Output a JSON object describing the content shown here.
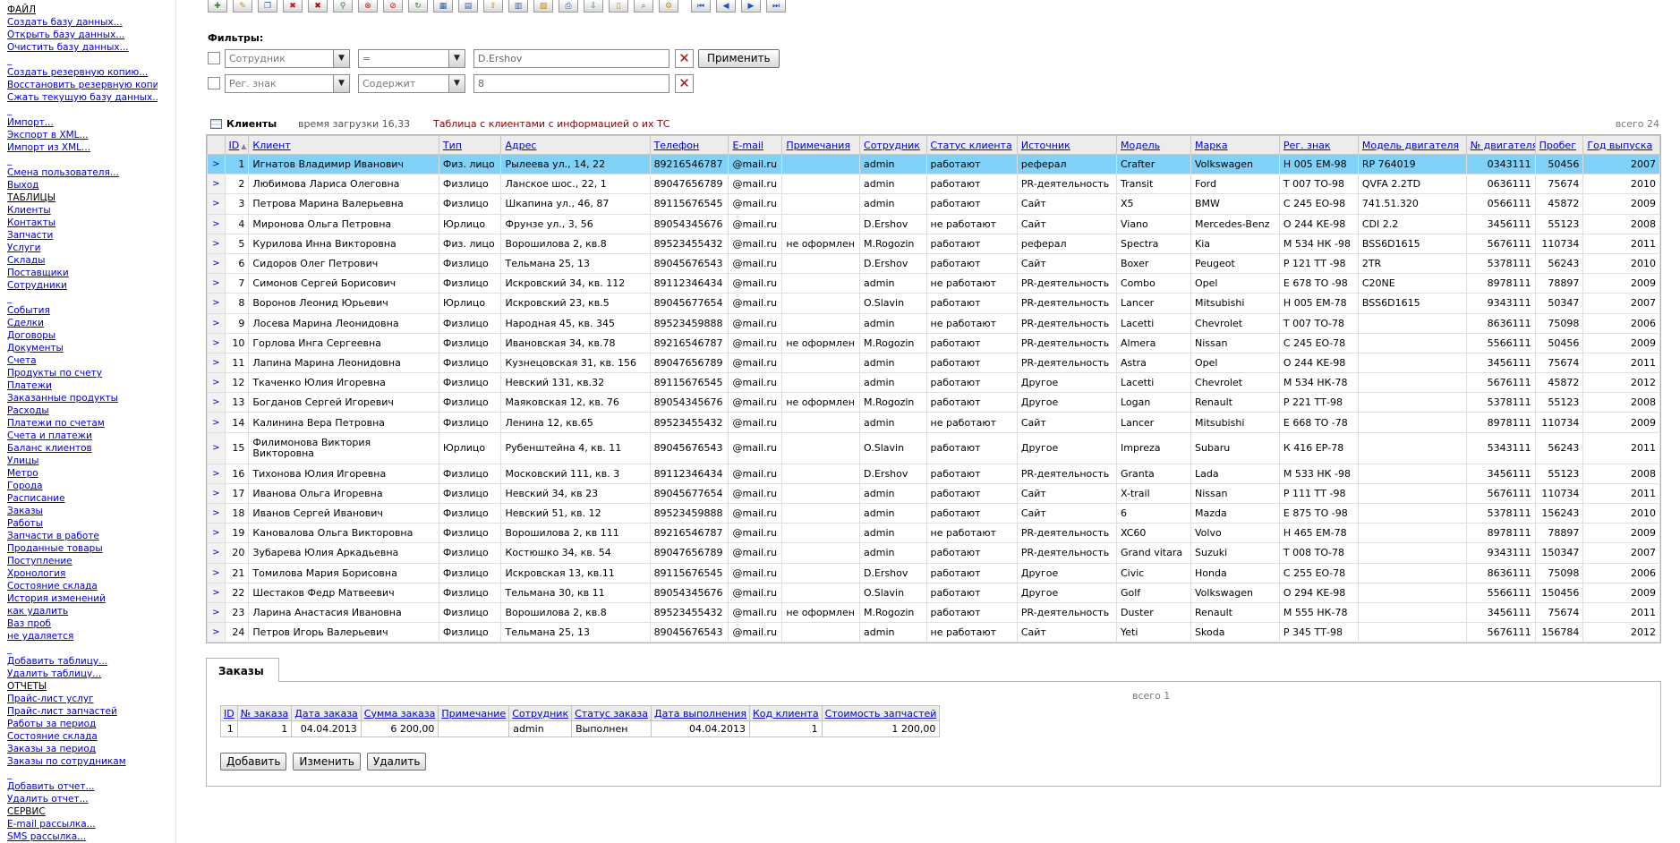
{
  "sidebar": {
    "items": [
      {
        "t": "ФАЙЛ",
        "k": "hdr"
      },
      {
        "t": "Создать базу данных...",
        "k": "lnk"
      },
      {
        "t": "Открыть базу данных...",
        "k": "lnk"
      },
      {
        "t": "Очистить базу данных...",
        "k": "lnk"
      },
      {
        "t": "_",
        "k": "sep"
      },
      {
        "t": "Создать резервную копию...",
        "k": "lnk"
      },
      {
        "t": "Восстановить резервную копию...",
        "k": "lnk"
      },
      {
        "t": "Сжать текущую базу данных...",
        "k": "lnk"
      },
      {
        "t": "_",
        "k": "sep"
      },
      {
        "t": "Импорт...",
        "k": "lnk"
      },
      {
        "t": "Экспорт в XML...",
        "k": "lnk"
      },
      {
        "t": "Импорт из XML...",
        "k": "lnk"
      },
      {
        "t": "_",
        "k": "sep"
      },
      {
        "t": "Смена пользователя...",
        "k": "lnk"
      },
      {
        "t": "Выход",
        "k": "lnk"
      },
      {
        "t": "ТАБЛИЦЫ",
        "k": "hdr"
      },
      {
        "t": "Клиенты",
        "k": "lnk"
      },
      {
        "t": "Контакты",
        "k": "lnk"
      },
      {
        "t": "Запчасти",
        "k": "lnk"
      },
      {
        "t": "Услуги",
        "k": "lnk"
      },
      {
        "t": "Склады",
        "k": "lnk"
      },
      {
        "t": "Поставщики",
        "k": "lnk"
      },
      {
        "t": "Сотрудники",
        "k": "lnk"
      },
      {
        "t": "_",
        "k": "sep"
      },
      {
        "t": "События",
        "k": "lnk"
      },
      {
        "t": "Сделки",
        "k": "lnk"
      },
      {
        "t": "Договоры",
        "k": "lnk"
      },
      {
        "t": "Документы",
        "k": "lnk"
      },
      {
        "t": "Счета",
        "k": "lnk"
      },
      {
        "t": "Продукты по счету",
        "k": "lnk"
      },
      {
        "t": "Платежи",
        "k": "lnk"
      },
      {
        "t": "Заказанные продукты",
        "k": "lnk"
      },
      {
        "t": "Расходы",
        "k": "lnk"
      },
      {
        "t": "Платежи по счетам",
        "k": "lnk"
      },
      {
        "t": "Счета и платежи",
        "k": "lnk"
      },
      {
        "t": "Баланс клиентов",
        "k": "lnk"
      },
      {
        "t": "Улицы",
        "k": "lnk"
      },
      {
        "t": "Метро",
        "k": "lnk"
      },
      {
        "t": "Города",
        "k": "lnk"
      },
      {
        "t": "Расписание",
        "k": "lnk"
      },
      {
        "t": "Заказы",
        "k": "lnk"
      },
      {
        "t": "Работы",
        "k": "lnk"
      },
      {
        "t": "Запчасти в работе",
        "k": "lnk"
      },
      {
        "t": "Проданные товары",
        "k": "lnk"
      },
      {
        "t": "Поступление",
        "k": "lnk"
      },
      {
        "t": "Хронология",
        "k": "lnk"
      },
      {
        "t": "Состояние склада",
        "k": "lnk"
      },
      {
        "t": "История изменений",
        "k": "lnk"
      },
      {
        "t": "как удалить",
        "k": "lnk"
      },
      {
        "t": "Ваз проб",
        "k": "lnk"
      },
      {
        "t": "не удаляется",
        "k": "lnk"
      },
      {
        "t": "_",
        "k": "sep"
      },
      {
        "t": "Добавить таблицу...",
        "k": "lnk"
      },
      {
        "t": "Удалить таблицу...",
        "k": "lnk"
      },
      {
        "t": "ОТЧЕТЫ",
        "k": "hdr"
      },
      {
        "t": "Прайс-лист услуг",
        "k": "lnk"
      },
      {
        "t": "Прайс-лист запчастей",
        "k": "lnk"
      },
      {
        "t": "Работы за период",
        "k": "lnk"
      },
      {
        "t": "Состояние склада",
        "k": "lnk"
      },
      {
        "t": "Заказы за период",
        "k": "lnk"
      },
      {
        "t": "Заказы по сотрудникам",
        "k": "lnk"
      },
      {
        "t": "_",
        "k": "sep"
      },
      {
        "t": "Добавить отчет...",
        "k": "lnk"
      },
      {
        "t": "Удалить отчет...",
        "k": "lnk"
      },
      {
        "t": "СЕРВИС",
        "k": "hdr"
      },
      {
        "t": "E-mail рассылка...",
        "k": "lnk"
      },
      {
        "t": "SMS рассылка...",
        "k": "lnk"
      }
    ]
  },
  "toolbar": {
    "buttons": [
      {
        "name": "add-record-icon",
        "glyph": "✚",
        "color": "#2f8a2f"
      },
      {
        "name": "edit-record-icon",
        "glyph": "✎",
        "color": "#c78a00"
      },
      {
        "name": "copy-record-icon",
        "glyph": "❐",
        "color": "#2f5fb0"
      },
      {
        "name": "delete-record-icon",
        "glyph": "✖",
        "color": "#d01010"
      },
      {
        "name": "delete-all-icon",
        "glyph": "✖",
        "color": "#b00000"
      },
      {
        "name": "filter-icon",
        "glyph": "⚲",
        "color": "#2f8a2f"
      },
      {
        "name": "clear-filter-icon",
        "glyph": "⊗",
        "color": "#d01010"
      },
      {
        "name": "remove-filter-icon",
        "glyph": "⊘",
        "color": "#d01010"
      },
      {
        "name": "refresh-icon",
        "glyph": "↻",
        "color": "#2f8a2f"
      },
      {
        "name": "columns-icon",
        "glyph": "▦",
        "color": "#2f5fb0"
      },
      {
        "name": "table-settings-icon",
        "glyph": "▤",
        "color": "#2f5fb0"
      },
      {
        "name": "export-icon",
        "glyph": "⇪",
        "color": "#c78a00"
      },
      {
        "name": "report-icon",
        "glyph": "▥",
        "color": "#2f5fb0"
      },
      {
        "name": "chart-icon",
        "glyph": "▧",
        "color": "#c78a00"
      },
      {
        "name": "print-icon",
        "glyph": "⎙",
        "color": "#2f5fb0"
      },
      {
        "name": "import-icon",
        "glyph": "⇩",
        "color": "#2f8a2f"
      },
      {
        "name": "document-icon",
        "glyph": "▯",
        "color": "#c78a00"
      },
      {
        "name": "search-icon",
        "glyph": "⌕",
        "color": "#2f5fb0"
      },
      {
        "name": "settings-icon",
        "glyph": "⚙",
        "color": "#c78a00"
      },
      {
        "name": "first-page-icon",
        "glyph": "⏮",
        "color": "#1a4fd0",
        "gap": true
      },
      {
        "name": "prev-page-icon",
        "glyph": "◀",
        "color": "#1a4fd0"
      },
      {
        "name": "next-page-icon",
        "glyph": "▶",
        "color": "#1a4fd0"
      },
      {
        "name": "last-page-icon",
        "glyph": "⏭",
        "color": "#1a4fd0"
      }
    ]
  },
  "filters": {
    "title": "Фильтры:",
    "apply_label": "Применить",
    "rows": [
      {
        "field": "Сотрудник",
        "op": "=",
        "value": "D.Ershov"
      },
      {
        "field": "Рег. знак",
        "op": "Содержит",
        "value": "8"
      }
    ]
  },
  "clients": {
    "title": "Клиенты",
    "load_time": "время загрузки 16,33",
    "description": "Таблица с клиентами с информацией о их ТС",
    "total": "всего 24",
    "columns": [
      "ID",
      "Клиент",
      "Тип",
      "Адрес",
      "Телефон",
      "E-mail",
      "Примечания",
      "Сотрудник",
      "Статус клиента",
      "Источник",
      "Модель",
      "Марка",
      "Рег. знак",
      "Модель двигателя",
      "№ двигателя",
      "Пробег",
      "Год выпуска"
    ],
    "id_sort_mark": "▲",
    "rows": [
      [
        "1",
        "Игнатов Владимир Иванович",
        "Физ. лицо",
        "Рылеева ул., 14, 22",
        "89216546787",
        "@mail.ru",
        "",
        "admin",
        "работают",
        "реферал",
        "Crafter",
        "Volkswagen",
        "Н 005 ЕМ-98",
        "RP 764019",
        "0343111",
        "50456",
        "2007"
      ],
      [
        "2",
        "Любимова Лариса Олеговна",
        "Физлицо",
        "Ланское шос., 22, 1",
        "89047656789",
        "@mail.ru",
        "",
        "admin",
        "работают",
        "PR-деятельность",
        "Transit",
        "Ford",
        "Т 007 ТО-98",
        "QVFA 2.2TD",
        "0636111",
        "75674",
        "2010"
      ],
      [
        "3",
        "Петрова Марина Валерьевна",
        "Физлицо",
        "Шкапина ул., 46, 87",
        "89115676545",
        "@mail.ru",
        "",
        "admin",
        "работают",
        "Сайт",
        "X5",
        "BMW",
        "С 245 ЕО-98",
        "741.51.320",
        "0566111",
        "45872",
        "2009"
      ],
      [
        "4",
        "Миронова Ольга Петровна",
        "Юрлицо",
        "Фрунзе ул., 3, 56",
        "89054345676",
        "@mail.ru",
        "",
        "D.Ershov",
        "не работают",
        "Сайт",
        "Viano",
        "Mercedes-Benz",
        "О 244 КЕ-98",
        "CDI 2.2",
        "3456111",
        "55123",
        "2008"
      ],
      [
        "5",
        "Курилова Инна Викторовна",
        "Физ. лицо",
        "Ворошилова 2, кв.8",
        "89523455432",
        "@mail.ru",
        "не оформлен",
        "M.Rogozin",
        "работают",
        "реферал",
        "Spectra",
        "Kia",
        "М 534 НК -98",
        "BSS6D1615",
        "5676111",
        "110734",
        "2011"
      ],
      [
        "6",
        "Сидоров Олег Петрович",
        "Физлицо",
        "Тельмана 25, 13",
        "89045676543",
        "@mail.ru",
        "",
        "D.Ershov",
        "работают",
        "Сайт",
        "Boxer",
        "Peugeot",
        "Р 121 ТТ -98",
        "2TR",
        "5378111",
        "56243",
        "2010"
      ],
      [
        "7",
        "Симонов Сергей Борисович",
        "Физлицо",
        "Искровский 34, кв. 112",
        "89112346434",
        "@mail.ru",
        "",
        "admin",
        "не работают",
        "PR-деятельность",
        "Combo",
        "Opel",
        "Е 678 ТО -98",
        "C20NE",
        "8978111",
        "78897",
        "2009"
      ],
      [
        "8",
        "Воронов Леонид Юрьевич",
        "Юрлицо",
        "Искровский 23, кв.5",
        "89045677654",
        "@mail.ru",
        "",
        "O.Slavin",
        "работают",
        "PR-деятельность",
        "Lancer",
        "Mitsubishi",
        "Н 005 ЕМ-78",
        "BSS6D1615",
        "9343111",
        "50347",
        "2007"
      ],
      [
        "9",
        "Лосева Марина Леонидовна",
        "Физлицо",
        "Народная 45, кв. 345",
        "89523459888",
        "@mail.ru",
        "",
        "admin",
        "не работают",
        "PR-деятельность",
        "Lacetti",
        "Chevrolet",
        "Т 007 ТО-78",
        "",
        "8636111",
        "75098",
        "2006"
      ],
      [
        "10",
        "Горлова Инга Сергеевна",
        "Физлицо",
        "Ивановская 34, кв.78",
        "89216546787",
        "@mail.ru",
        "не оформлен",
        "M.Rogozin",
        "работают",
        "PR-деятельность",
        "Almera",
        "Nissan",
        "С 245 ЕО-78",
        "",
        "5566111",
        "50456",
        "2009"
      ],
      [
        "11",
        "Лапина Марина Леонидовна",
        "Физлицо",
        "Кузнецовская 31, кв. 156",
        "89047656789",
        "@mail.ru",
        "",
        "admin",
        "работают",
        "PR-деятельность",
        "Astra",
        "Opel",
        "О 244 КЕ-98",
        "",
        "3456111",
        "75674",
        "2011"
      ],
      [
        "12",
        "Ткаченко Юлия Игоревна",
        "Физлицо",
        "Невский 131, кв.32",
        "89115676545",
        "@mail.ru",
        "",
        "admin",
        "работают",
        "Другое",
        "Lacetti",
        "Chevrolet",
        "М 534 НК-78",
        "",
        "5676111",
        "45872",
        "2012"
      ],
      [
        "13",
        "Богданов Сергей Игоревич",
        "Физлицо",
        "Маяковская 12, кв. 76",
        "89054345676",
        "@mail.ru",
        "не оформлен",
        "M.Rogozin",
        "работают",
        "Другое",
        "Logan",
        "Renault",
        "Р 221 ТТ-98",
        "",
        "5378111",
        "55123",
        "2008"
      ],
      [
        "14",
        "Калинина Вера Петровна",
        "Физлицо",
        "Ленина 12, кв.65",
        "89523455432",
        "@mail.ru",
        "",
        "admin",
        "не работают",
        "Сайт",
        "Lancer",
        "Mitsubishi",
        "Е 668 ТО -78",
        "",
        "8978111",
        "110734",
        "2009"
      ],
      [
        "15",
        "Филимонова Виктория Викторовна",
        "Юрлицо",
        "Рубенштейна 4, кв. 11",
        "89045676543",
        "@mail.ru",
        "",
        "O.Slavin",
        "работают",
        "Другое",
        "Impreza",
        "Subaru",
        "К 416 ЕР-78",
        "",
        "5343111",
        "56243",
        "2011"
      ],
      [
        "16",
        "Тихонова Юлия Игоревна",
        "Физлицо",
        "Московский 111, кв. 3",
        "89112346434",
        "@mail.ru",
        "",
        "D.Ershov",
        "работают",
        "PR-деятельность",
        "Granta",
        "Lada",
        "М 533 НК -98",
        "",
        "3456111",
        "55123",
        "2008"
      ],
      [
        "17",
        "Иванова Ольга Игоревна",
        "Физлицо",
        "Невский 34, кв 23",
        "89045677654",
        "@mail.ru",
        "",
        "admin",
        "работают",
        "Сайт",
        "X-trail",
        "Nissan",
        "Р 111 ТТ -98",
        "",
        "5676111",
        "110734",
        "2011"
      ],
      [
        "18",
        "Иванов Сергей Иванович",
        "Физлицо",
        "Невский 51, кв. 12",
        "89523459888",
        "@mail.ru",
        "",
        "admin",
        "работают",
        "Сайт",
        "6",
        "Mazda",
        "Е 875 ТО -98",
        "",
        "5378111",
        "156243",
        "2010"
      ],
      [
        "19",
        "Кановалова Ольга Викторовна",
        "Физлицо",
        "Ворошилова 2, кв 111",
        "89216546787",
        "@mail.ru",
        "",
        "admin",
        "не работают",
        "PR-деятельность",
        "XC60",
        "Volvo",
        "Н 465 ЕМ-78",
        "",
        "8978111",
        "78897",
        "2009"
      ],
      [
        "20",
        "Зубарева Юлия Аркадьевна",
        "Физлицо",
        "Костюшко 34, кв. 54",
        "89047656789",
        "@mail.ru",
        "",
        "admin",
        "работают",
        "PR-деятельность",
        "Grand vitara",
        "Suzuki",
        "Т 008 ТО-78",
        "",
        "9343111",
        "150347",
        "2007"
      ],
      [
        "21",
        "Томилова Мария Борисовна",
        "Физлицо",
        "Искровская 13, кв.11",
        "89115676545",
        "@mail.ru",
        "",
        "D.Ershov",
        "работают",
        "Другое",
        "Civic",
        "Honda",
        "С 255 ЕО-78",
        "",
        "8636111",
        "75098",
        "2006"
      ],
      [
        "22",
        "Шестаков Федр Матвеевич",
        "Физлицо",
        "Тельмана 30, кв 11",
        "89054345676",
        "@mail.ru",
        "",
        "O.Slavin",
        "работают",
        "Другое",
        "Golf",
        "Volkswagen",
        "О 294 КЕ-98",
        "",
        "5566111",
        "150456",
        "2009"
      ],
      [
        "23",
        "Ларина Анастасия Ивановна",
        "Физлицо",
        "Ворошилова 2, кв.8",
        "89523455432",
        "@mail.ru",
        "не оформлен",
        "M.Rogozin",
        "работают",
        "PR-деятельность",
        "Duster",
        "Renault",
        "М 555 НК-78",
        "",
        "3456111",
        "75674",
        "2011"
      ],
      [
        "24",
        "Петров Игорь Валерьевич",
        "Физлицо",
        "Тельмана 25, 13",
        "89045676543",
        "@mail.ru",
        "",
        "admin",
        "не работают",
        "Сайт",
        "Yeti",
        "Skoda",
        "Р 345 ТТ-98",
        "",
        "5676111",
        "156784",
        "2012"
      ]
    ]
  },
  "orders": {
    "tab_label": "Заказы",
    "total": "всего 1",
    "columns": [
      "ID",
      "№ заказа",
      "Дата заказа",
      "Сумма заказа",
      "Примечание",
      "Сотрудник",
      "Статус заказа",
      "Дата выполнения",
      "Код клиента",
      "Стоимость запчастей"
    ],
    "rows": [
      [
        "1",
        "1",
        "04.04.2013",
        "6 200,00",
        "",
        "admin",
        "Выполнен",
        "04.04.2013",
        "1",
        "1 200,00"
      ]
    ],
    "add_label": "Добавить",
    "edit_label": "Изменить",
    "delete_label": "Удалить"
  },
  "colors": {
    "selected_row": "#7fd1f7",
    "link": "#0000cc",
    "description": "#8b0000"
  }
}
